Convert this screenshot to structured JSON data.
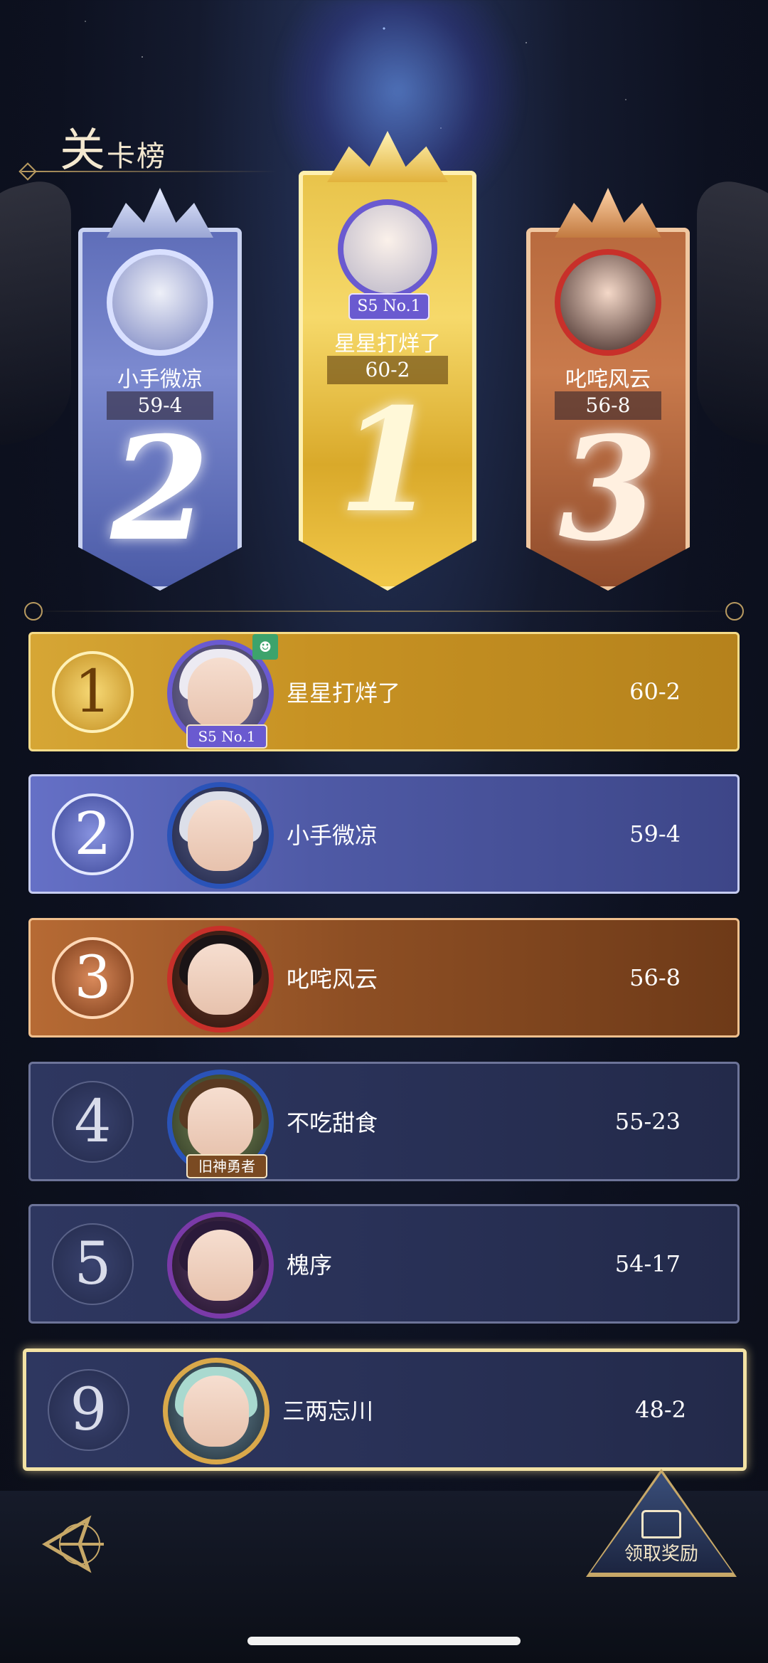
{
  "page": {
    "title_big": "关",
    "title_small": "卡榜"
  },
  "podium": [
    {
      "rank": "2",
      "name": "小手微凉",
      "score": "59-4",
      "label": ""
    },
    {
      "rank": "1",
      "name": "星星打烊了",
      "score": "60-2",
      "label": "S5 No.1"
    },
    {
      "rank": "3",
      "name": "叱咤风云",
      "score": "56-8",
      "label": ""
    }
  ],
  "rows": [
    {
      "rank": "1",
      "name": "星星打烊了",
      "score": "60-2",
      "label": "S5 No.1",
      "friend": true
    },
    {
      "rank": "2",
      "name": "小手微凉",
      "score": "59-4",
      "label": ""
    },
    {
      "rank": "3",
      "name": "叱咤风云",
      "score": "56-8",
      "label": ""
    },
    {
      "rank": "4",
      "name": "不吃甜食",
      "score": "55-23",
      "label": "旧神勇者"
    },
    {
      "rank": "5",
      "name": "槐序",
      "score": "54-17",
      "label": ""
    },
    {
      "rank": "9",
      "name": "三两忘川",
      "score": "48-2",
      "label": ""
    }
  ],
  "buttons": {
    "reward_label": "领取奖励"
  },
  "colors": {
    "gold": "#d6a635",
    "silver": "#5e6db8",
    "bronze": "#b86a3e",
    "self_highlight": "#f3e2a4"
  },
  "icons": {
    "back": "back-arrow-icon",
    "friend": "friend-icon",
    "reward": "treasure-chest-icon"
  }
}
